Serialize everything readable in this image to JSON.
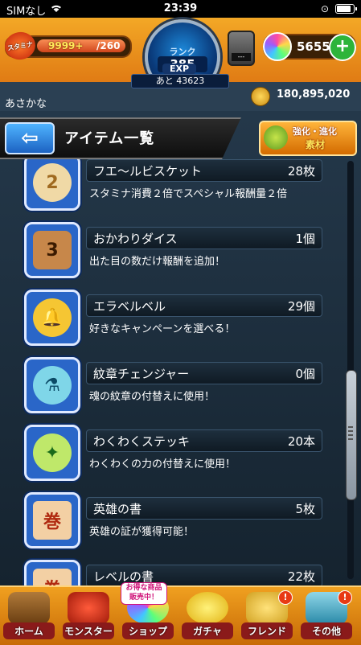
{
  "status_bar": {
    "carrier": "SIMなし",
    "time": "23:39"
  },
  "header": {
    "stamina_label": "スタミナ",
    "stamina_value": "9999+",
    "stamina_max": "/260",
    "rank_label": "ランク",
    "rank_value": "385",
    "exp_label": "EXP",
    "exp_remaining": "あと 43623",
    "device_label": "---",
    "orb_count": "5655",
    "plus_label": "+"
  },
  "user": {
    "name": "あさかな",
    "coins": "180,895,020"
  },
  "banner": {
    "back_label": "⇦",
    "title": "アイテム一覧",
    "kyoka_line1": "強化・進化",
    "kyoka_line2": "素材"
  },
  "items": [
    {
      "name": "フエ〜ルビスケット",
      "qty": "28枚",
      "desc": "スタミナ消費２倍でスペシャル報酬量２倍",
      "icon": "biscuit-icon",
      "glyph": "2"
    },
    {
      "name": "おかわりダイス",
      "qty": "1個",
      "desc": "出た目の数だけ報酬を追加！",
      "icon": "dice-icon",
      "glyph": "3"
    },
    {
      "name": "エラベルベル",
      "qty": "29個",
      "desc": "好きなキャンペーンを選べる！",
      "icon": "bell-icon",
      "glyph": "🔔"
    },
    {
      "name": "紋章チェンジャー",
      "qty": "0個",
      "desc": "魂の紋章の付替えに使用！",
      "icon": "changer-icon",
      "glyph": "⚗"
    },
    {
      "name": "わくわくステッキ",
      "qty": "20本",
      "desc": "わくわくの力の付替えに使用！",
      "icon": "wand-icon",
      "glyph": "✦"
    },
    {
      "name": "英雄の書",
      "qty": "5枚",
      "desc": "英雄の証が獲得可能！",
      "icon": "scroll-icon",
      "glyph": "巻"
    },
    {
      "name": "レベルの書",
      "qty": "22枚",
      "desc": "",
      "icon": "level-book-icon",
      "glyph": "巻"
    }
  ],
  "nav": {
    "home": "ホーム",
    "monster": "モンスター",
    "shop": "ショップ",
    "gacha": "ガチャ",
    "friend": "フレンド",
    "other": "その他",
    "promo": "お得な商品\n販売中！",
    "alert": "!"
  },
  "colors": {
    "accent": "#f0a020",
    "panel": "#1b2a38",
    "plus": "#2db43a"
  }
}
